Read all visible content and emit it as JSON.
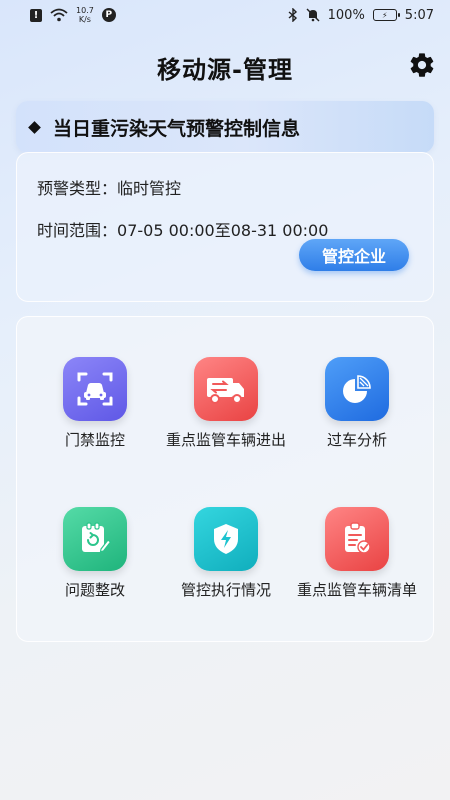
{
  "status_bar": {
    "net_speed_value": "10.7",
    "net_speed_unit": "K/s",
    "battery": "100%",
    "time": "5:07"
  },
  "header": {
    "title": "移动源-管理"
  },
  "banner": {
    "title": "当日重污染天气预警控制信息"
  },
  "warning_info": {
    "type_label": "预警类型：",
    "type_value": "临时管控",
    "time_label": "时间范围：",
    "time_value": "07-05 00:00至08-31 00:00",
    "button_label": "管控企业"
  },
  "features": [
    {
      "label": "门禁监控",
      "icon": "car-scan-icon",
      "color": "#6f68ef"
    },
    {
      "label": "重点监管车辆进出",
      "icon": "truck-icon",
      "color": "#f15a5a"
    },
    {
      "label": "过车分析",
      "icon": "pie-chart-icon",
      "color": "#2f7fed"
    },
    {
      "label": "问题整改",
      "icon": "clipboard-edit-icon",
      "color": "#2bc58c"
    },
    {
      "label": "管控执行情况",
      "icon": "shield-bolt-icon",
      "color": "#1cc3cf"
    },
    {
      "label": "重点监管车辆清单",
      "icon": "checklist-icon",
      "color": "#f15a5a"
    }
  ]
}
